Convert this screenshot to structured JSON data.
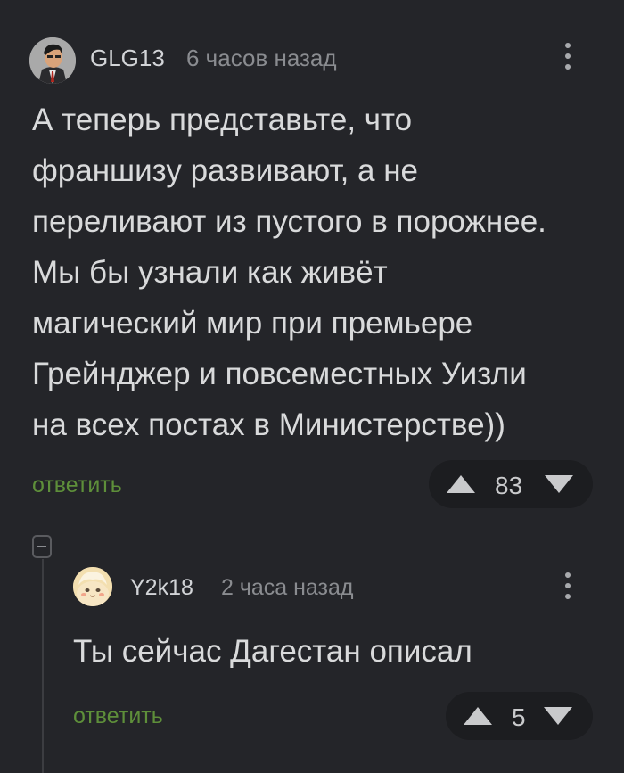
{
  "comment1": {
    "username": "GLG13",
    "timestamp": "6 часов назад",
    "lines": [
      "А теперь представьте, что",
      "франшизу развивают, а не",
      "переливают из пустого в порожнее.",
      "Мы бы узнали как живёт",
      "магический мир при премьере",
      "Грейнджер и повсеместных Уизли",
      "на всех постах в Министерстве))"
    ],
    "reply_label": "ответить",
    "rating": "83"
  },
  "comment2": {
    "username": "Y2k18",
    "timestamp": "2 часа назад",
    "text": "Ты сейчас Дагестан описал",
    "reply_label": "ответить",
    "rating": "5"
  },
  "colors": {
    "background": "#242529",
    "reply_link": "#5e8f3a",
    "text": "#d9dadb",
    "muted": "#8a8c90"
  },
  "icons": {
    "more": "more-vertical-icon",
    "upvote": "arrow-up-icon",
    "downvote": "arrow-down-icon",
    "collapse": "collapse-thread-icon"
  }
}
